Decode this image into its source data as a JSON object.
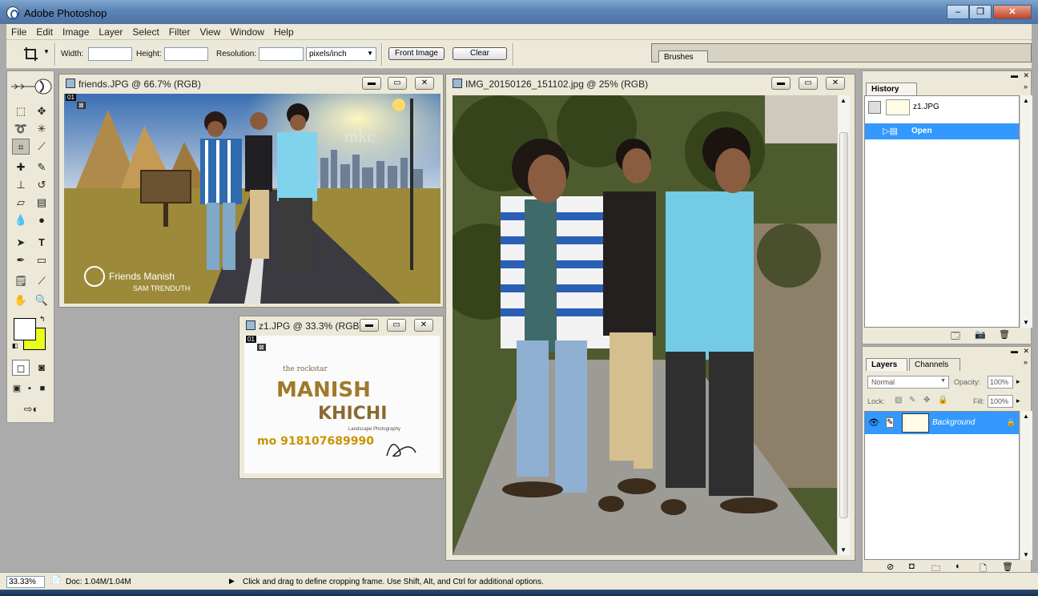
{
  "app": {
    "title": "Adobe Photoshop"
  },
  "menu": [
    "File",
    "Edit",
    "Image",
    "Layer",
    "Select",
    "Filter",
    "View",
    "Window",
    "Help"
  ],
  "options": {
    "width_label": "Width:",
    "height_label": "Height:",
    "resolution_label": "Resolution:",
    "resolution_unit": "pixels/inch",
    "front_image": "Front Image",
    "clear": "Clear",
    "brushes_tab": "Brushes"
  },
  "documents": {
    "friends": {
      "title": "friends.JPG @ 66.7% (RGB)",
      "badge": "01",
      "overlay": {
        "brand": "Friends Manish",
        "tagline": "SAM TRENDUTH",
        "watermark": "mkc"
      }
    },
    "z1": {
      "title": "z1.JPG @ 33.3% (RGB)",
      "badge": "01",
      "logo": {
        "small": "the rockstar",
        "name1": "MANISH",
        "name2": "KHICHI",
        "sub": "Landscape Photography",
        "phone": "mo  918107689990"
      }
    },
    "img": {
      "title": "IMG_20150126_151102.jpg @ 25% (RGB)"
    }
  },
  "history": {
    "tab": "History",
    "snapshot_label": "z1.JPG",
    "items": [
      {
        "label": "Open"
      }
    ]
  },
  "layers": {
    "tabs": [
      "Layers",
      "Channels"
    ],
    "blend_mode": "Normal",
    "opacity_label": "Opacity:",
    "opacity": "100%",
    "lock_label": "Lock:",
    "fill_label": "Fill:",
    "fill": "100%",
    "items": [
      {
        "name": "Background"
      }
    ]
  },
  "status": {
    "zoom": "33.33%",
    "doc": "Doc: 1.04M/1.04M",
    "hint": "Click and drag to define cropping frame. Use Shift, Alt, and Ctrl for additional options."
  },
  "colors": {
    "foreground": "#ffffff",
    "background": "#e9ff1a",
    "selection": "#3399ff"
  }
}
